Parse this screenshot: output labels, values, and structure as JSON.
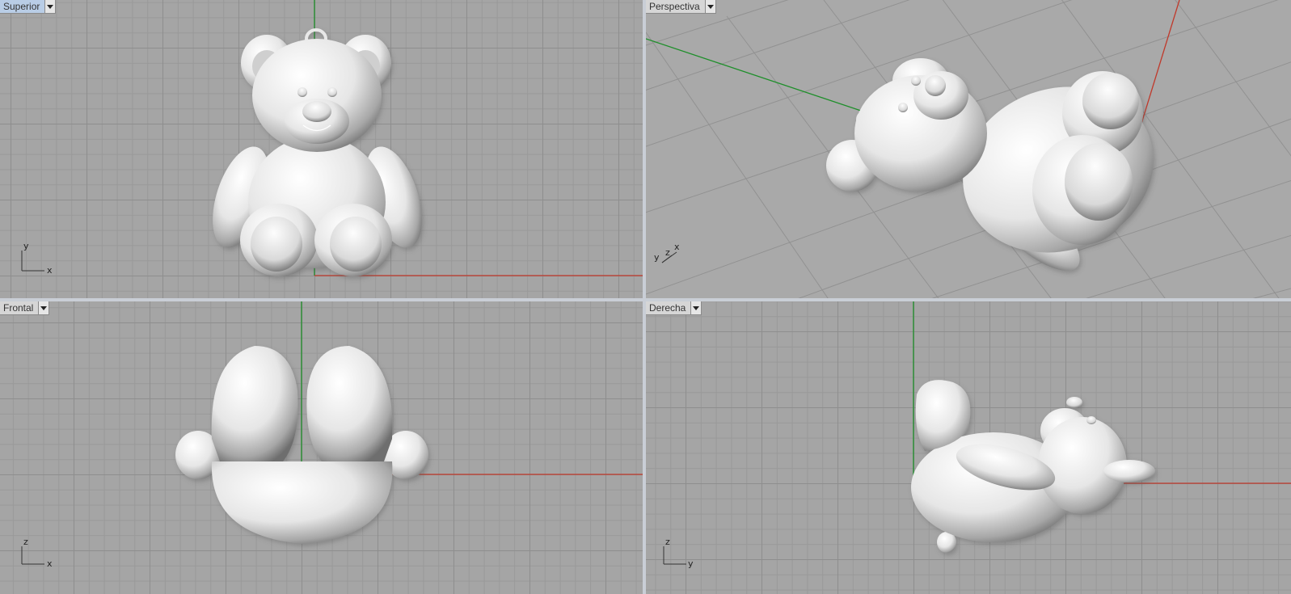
{
  "viewports": {
    "top": {
      "label": "Superior",
      "axis_h": "x",
      "axis_v": "y"
    },
    "persp": {
      "label": "Perspectiva",
      "axis_a": "y",
      "axis_b": "z",
      "axis_c": "x"
    },
    "front": {
      "label": "Frontal",
      "axis_h": "x",
      "axis_v": "z"
    },
    "right": {
      "label": "Derecha",
      "axis_h": "y",
      "axis_v": "z"
    }
  },
  "colors": {
    "x_axis": "#c0392b",
    "y_axis": "#1e8f2a",
    "active_tab": "#b9cde6"
  },
  "icons": {
    "dropdown": "chevron-down-icon"
  }
}
